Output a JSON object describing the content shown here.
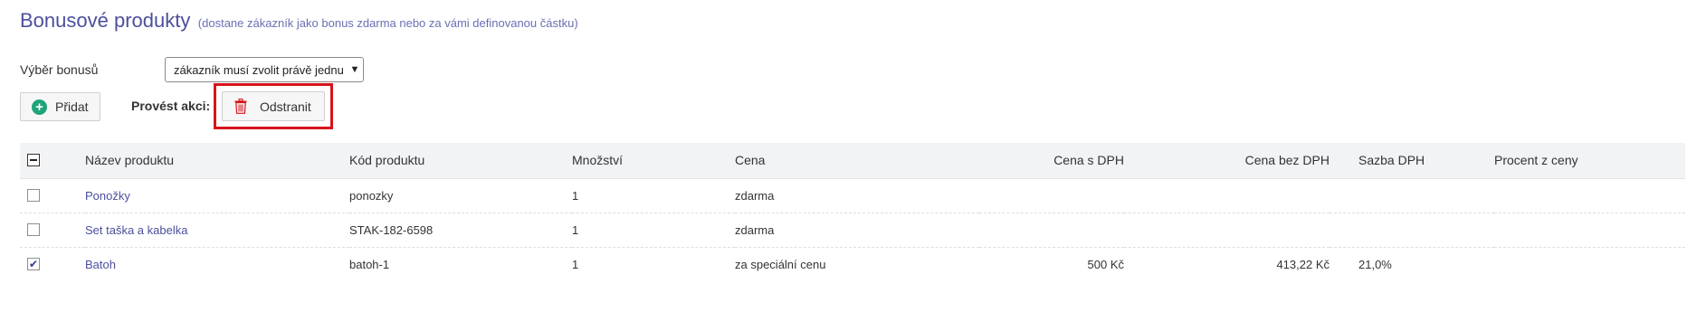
{
  "header": {
    "title": "Bonusové produkty",
    "subtitle": "(dostane zákazník jako bonus zdarma nebo za vámi definovanou částku)"
  },
  "bonus_select": {
    "label": "Výběr bonusů",
    "value": "zákazník musí zvolit právě jednu"
  },
  "toolbar": {
    "add_label": "Přidat",
    "action_label": "Provést akci:",
    "remove_label": "Odstranit"
  },
  "table": {
    "columns": {
      "name": "Název produktu",
      "code": "Kód produktu",
      "qty": "Množství",
      "price": "Cena",
      "price_vat": "Cena s DPH",
      "price_novat": "Cena bez DPH",
      "vat_rate": "Sazba DPH",
      "percent": "Procent z ceny"
    },
    "rows": [
      {
        "checked": false,
        "name": "Ponožky",
        "code": "ponozky",
        "qty": "1",
        "price": "zdarma",
        "price_vat": "",
        "price_novat": "",
        "vat_rate": "",
        "percent": ""
      },
      {
        "checked": false,
        "name": "Set taška a kabelka",
        "code": "STAK-182-6598",
        "qty": "1",
        "price": "zdarma",
        "price_vat": "",
        "price_novat": "",
        "vat_rate": "",
        "percent": ""
      },
      {
        "checked": true,
        "name": "Batoh",
        "code": "batoh-1",
        "qty": "1",
        "price": "za speciální cenu",
        "price_vat": "500 Kč",
        "price_novat": "413,22 Kč",
        "vat_rate": "21,0%",
        "percent": ""
      }
    ]
  },
  "colors": {
    "title": "#4b4f9c",
    "add_icon": "#1fa37a",
    "remove_icon": "#d7141a",
    "highlight": "#d7141a"
  }
}
